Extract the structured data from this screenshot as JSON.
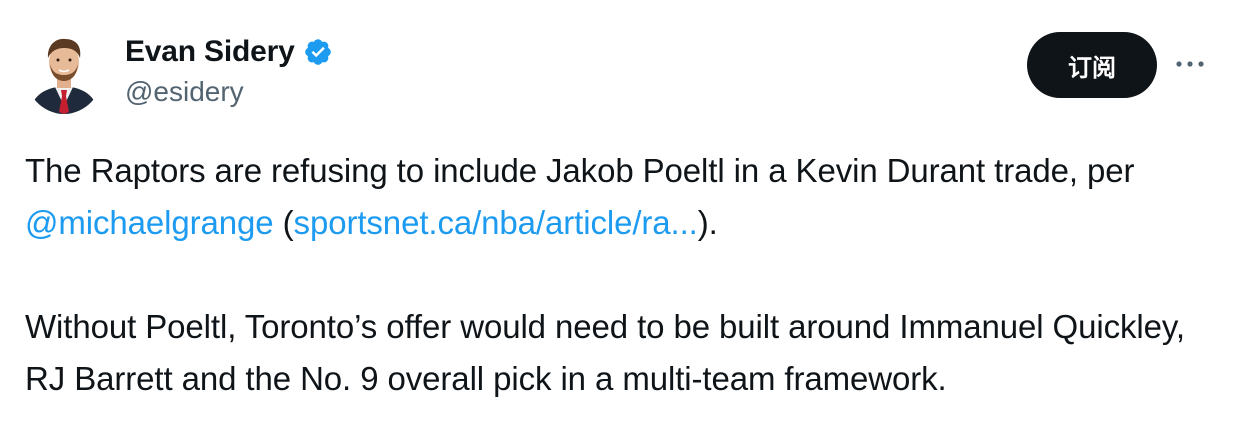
{
  "author": {
    "display_name": "Evan Sidery",
    "handle": "@esidery",
    "verified": true,
    "verified_icon": "verified-badge-icon",
    "avatar_icon": "profile-photo"
  },
  "actions": {
    "subscribe_label": "订阅",
    "more_icon": "more-options-icon"
  },
  "tweet": {
    "paragraph1": {
      "text_before": "The Raptors are refusing to include Jakob Poeltl in a Kevin Durant trade, per ",
      "mention": "@michaelgrange",
      "text_middle": " (",
      "link": "sportsnet.ca/nba/article/ra...",
      "text_after": ")."
    },
    "paragraph2": "Without Poeltl, Toronto’s offer would need to be built around Immanuel Quickley, RJ Barrett and the No. 9 overall pick in a multi-team framework."
  },
  "colors": {
    "text": "#0f1419",
    "secondary_text": "#536471",
    "link": "#1d9bf0",
    "button_bg": "#0f1419",
    "verified": "#1d9bf0"
  }
}
